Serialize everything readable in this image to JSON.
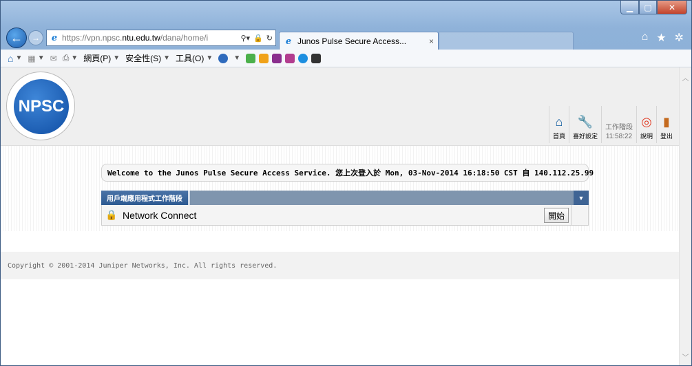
{
  "browser": {
    "url_scheme": "https://vpn.npsc.",
    "url_host": "ntu.edu.tw",
    "url_path": "/dana/home/i",
    "tab_title": "Junos Pulse Secure Access...",
    "tab_close": "×"
  },
  "commandbar": {
    "page_menu": "網頁(P)",
    "safety_menu": "安全性(S)",
    "tools_menu": "工具(O)"
  },
  "logo": {
    "text": "NPSC"
  },
  "topnav": {
    "home_label": "首頁",
    "prefs_label": "喜好設定",
    "session_label": "工作階段",
    "session_time": "11:58:22",
    "help_label": "說明",
    "logout_label": "登出"
  },
  "welcome": {
    "message": "Welcome to the Junos Pulse Secure Access Service. 您上次登入於 Mon, 03-Nov-2014 16:18:50 CST 自 140.112.25.99"
  },
  "panel": {
    "tab_label": "用戶端應用程式工作階段",
    "item_label": "Network Connect",
    "start_button": "開始"
  },
  "footer": {
    "copyright": "Copyright © 2001-2014 Juniper Networks, Inc. All rights reserved."
  }
}
